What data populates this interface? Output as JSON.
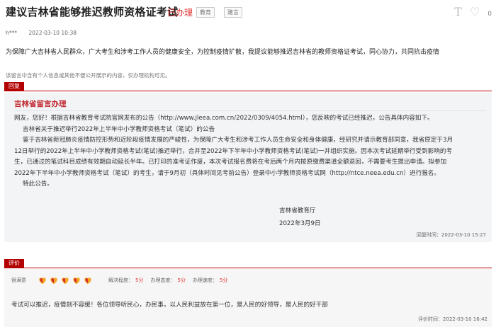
{
  "header": {
    "title": "建议吉林省能够推迟教师资格证考试",
    "status": "已办理",
    "tags": [
      "教育",
      "建言"
    ],
    "font_icon": "T",
    "heart_count": "0"
  },
  "meta": {
    "author": "h***",
    "time": "2022-03-10 10:38"
  },
  "message": "为保障广大吉林省人民群众，广大考生和涉考工作人员的健康安全，为控制疫情扩散，我提议能够推迟吉林省的教师资格证考试，同心协力，共同抗击疫情",
  "notice": "该留言中含有个人信息或其他不便公开展示的内容，仅办理机构可见。",
  "reply": {
    "section_label": "回复",
    "org": "吉林省留言办理",
    "lines": [
      "网友，您好！根据吉林省教育考试院官网发布的公告（http://www.jleea.com.cn/2022/0309/4054.html），您反映的考试已经推迟，公告具体内容如下。",
      "吉林省关于推迟举行2022年上半年中小学教师资格考试（笔试）的公告",
      "鉴于吉林省新冠肺炎疫情防控形势和近阶段疫情发展的严峻性，为保障广大考生和涉考工作人员生命安全和身体健康，经研究并请示教育部同意，我省原定于3月",
      "12日举行的2022年上半年中小学教师资格考试(笔试)推迟举行，合并至2022年下半年中小学教师资格考试(笔试)一并组织实施。因本次考试延期举行受到影响的考",
      "生，已通过的笔试科目成绩有效期自动延长半年。已打印的准考证作废，本次考试报名费将在考后两个月内按原缴费渠道全额退回，不需要考生提出申请。拟参加",
      "2022年下半年中小学教师资格考试（笔试）的考生，请于9月初（具体时间见考前公告）登录中小学教师资格考试网（http://ntce.neea.edu.cn）进行报名。",
      "特此公告。"
    ],
    "sign_org": "吉林省教育厅",
    "sign_date": "2022年3月9日",
    "reply_time": "回复时间：2022-03-10 15:27"
  },
  "evaluation": {
    "section_label": "评价",
    "rating_label": "很满意",
    "hearts": 5,
    "scores": [
      {
        "label": "解决程度：",
        "value": "5分"
      },
      {
        "label": "办理态度：",
        "value": "5分"
      },
      {
        "label": "办理速度：",
        "value": "5分"
      }
    ],
    "text": "考试可以推迟，疫情刻不容缓！各位领导听民心，办民事，以人民利益放在第一位，是人民的好领导，是人民的好干部",
    "time": "评价时间：2022-03-10 16:42"
  },
  "colors": {
    "accent": "#b30000",
    "status": "#e0312f",
    "org": "#c0262d"
  }
}
